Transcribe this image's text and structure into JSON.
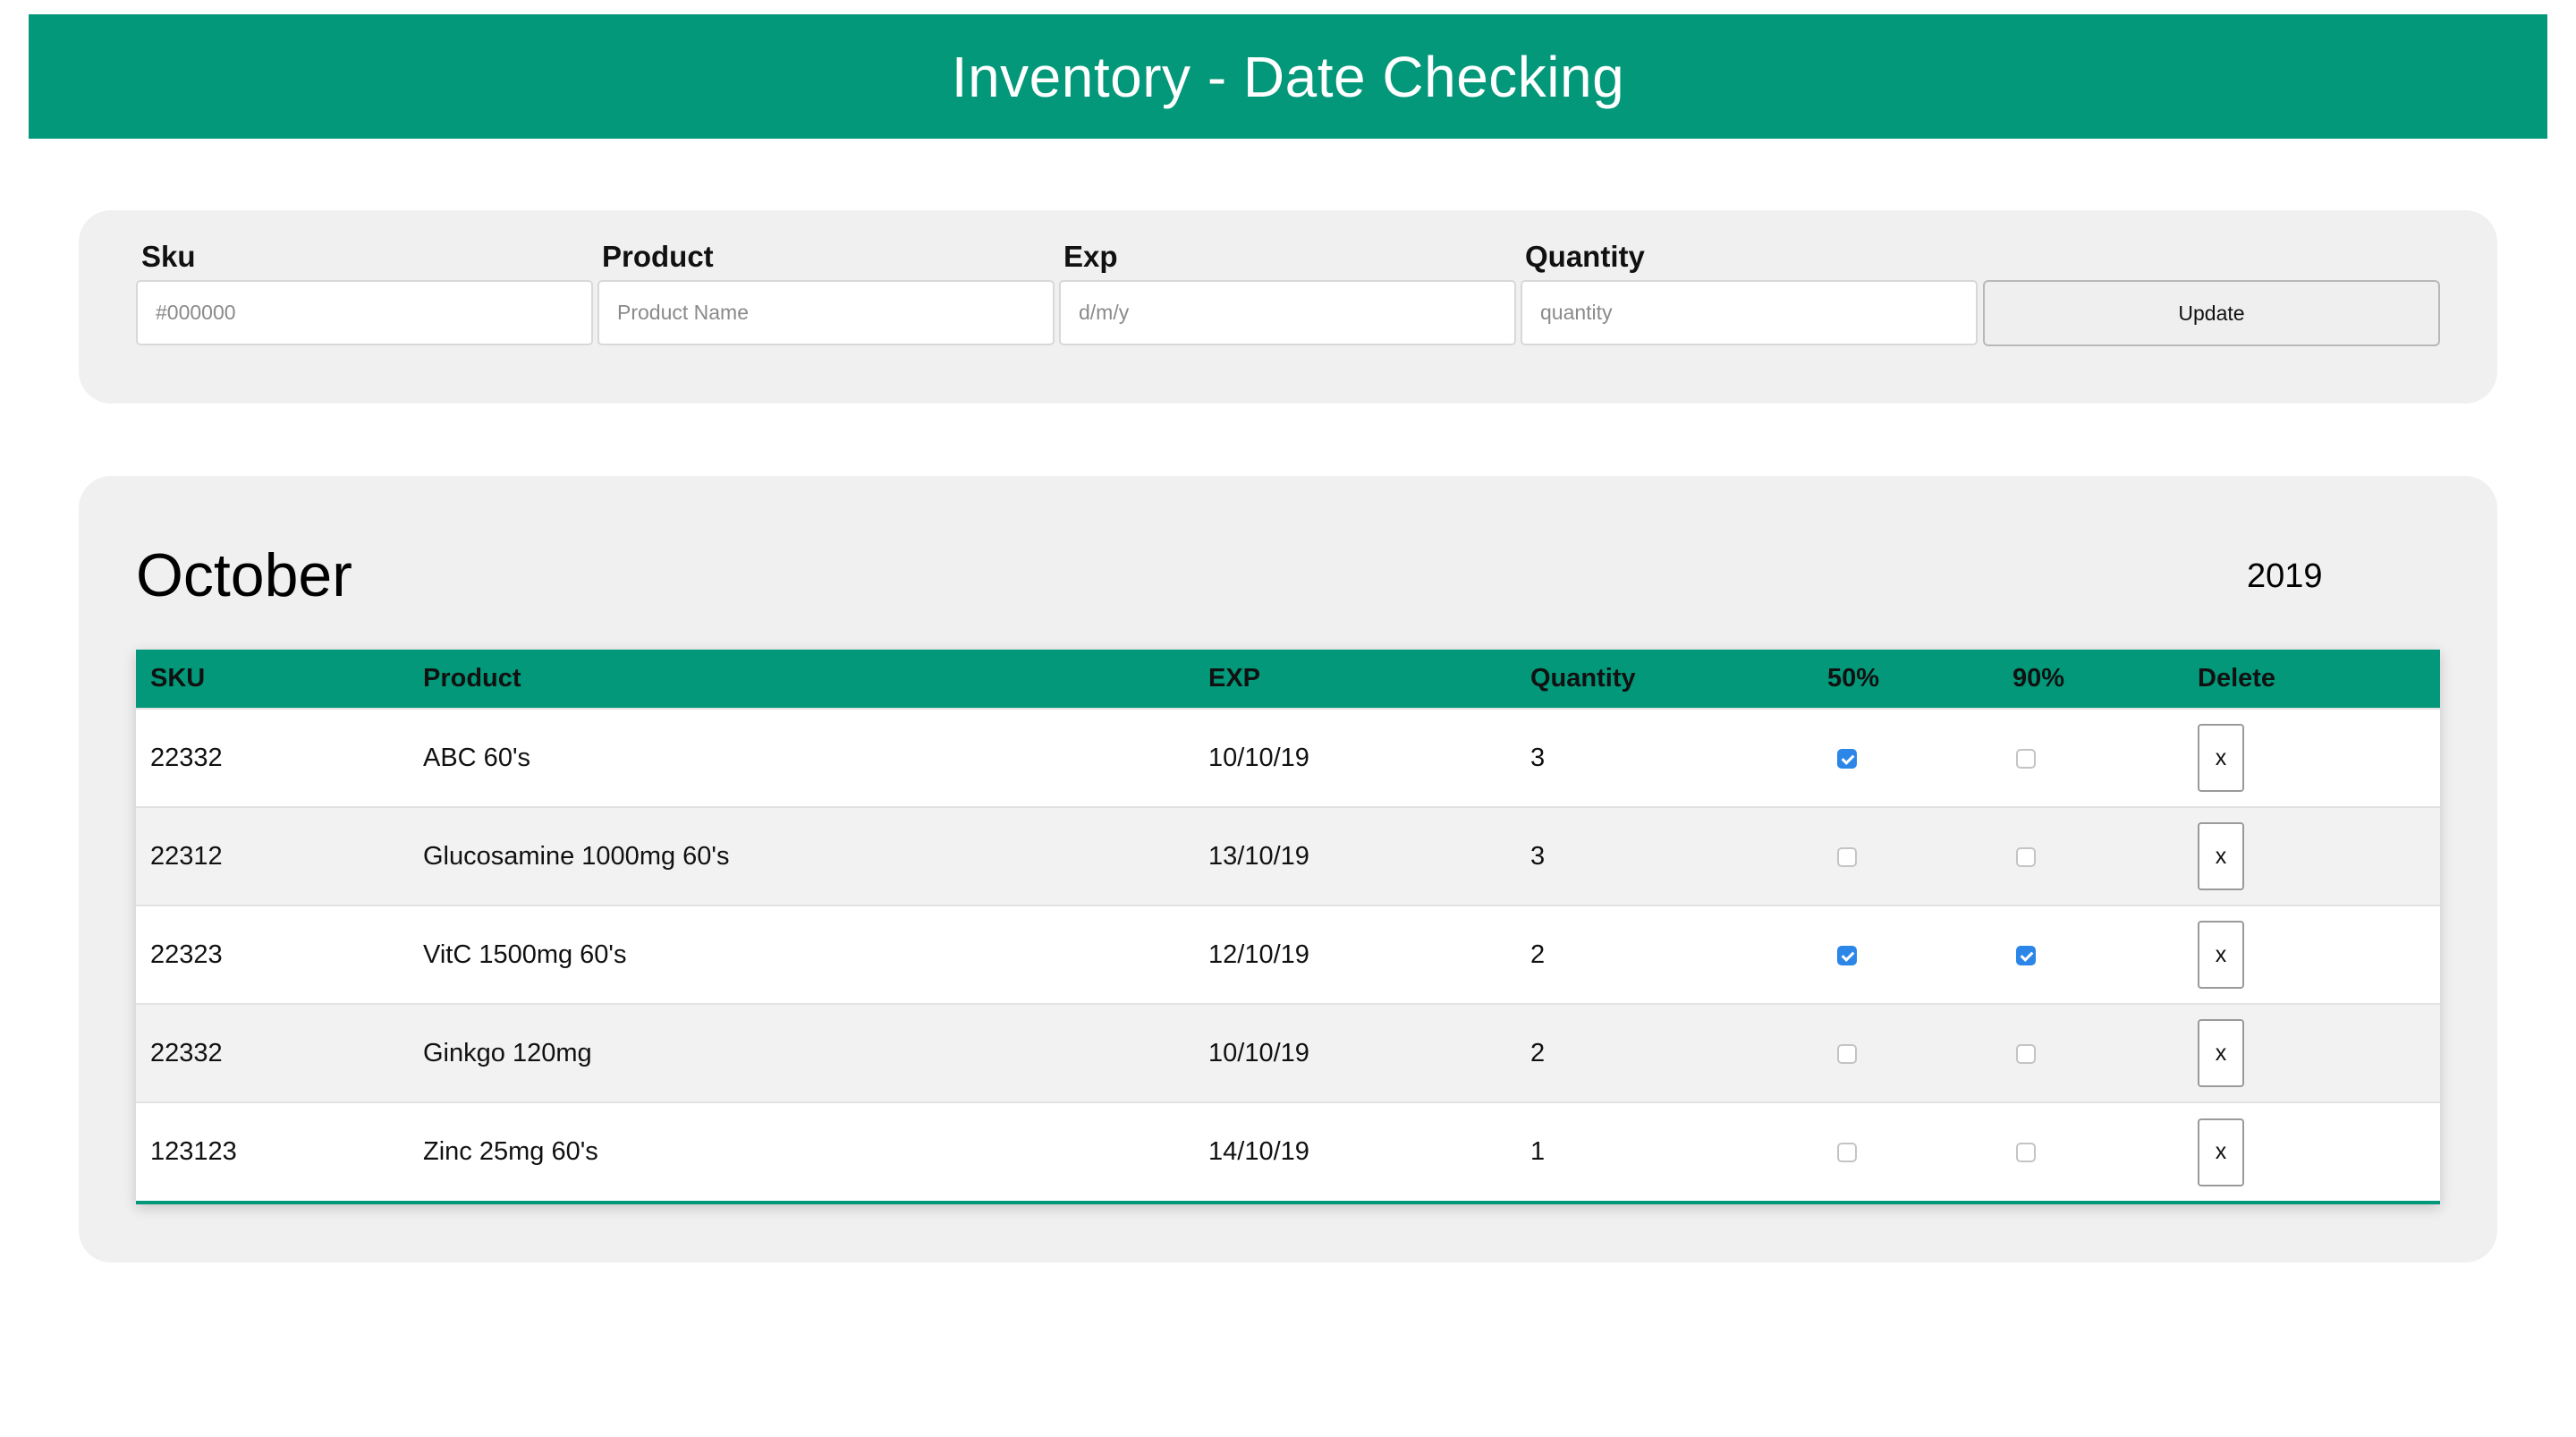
{
  "header": {
    "title": "Inventory - Date Checking"
  },
  "form": {
    "sku_label": "Sku",
    "sku_placeholder": "#000000",
    "product_label": "Product",
    "product_placeholder": "Product Name",
    "exp_label": "Exp",
    "exp_placeholder": "d/m/y",
    "quantity_label": "Quantity",
    "quantity_placeholder": "quantity",
    "update_label": "Update"
  },
  "list": {
    "month": "October",
    "year": "2019",
    "columns": {
      "sku": "SKU",
      "product": "Product",
      "exp": "EXP",
      "quantity": "Quantity",
      "p50": "50%",
      "p90": "90%",
      "delete": "Delete"
    },
    "delete_label": "x",
    "rows": [
      {
        "sku": "22332",
        "product": "ABC 60's",
        "exp": "10/10/19",
        "quantity": "3",
        "p50": true,
        "p90": false
      },
      {
        "sku": "22312",
        "product": "Glucosamine 1000mg 60's",
        "exp": "13/10/19",
        "quantity": "3",
        "p50": false,
        "p90": false
      },
      {
        "sku": "22323",
        "product": "VitC 1500mg 60's",
        "exp": "12/10/19",
        "quantity": "2",
        "p50": true,
        "p90": true
      },
      {
        "sku": "22332",
        "product": "Ginkgo 120mg",
        "exp": "10/10/19",
        "quantity": "2",
        "p50": false,
        "p90": false
      },
      {
        "sku": "123123",
        "product": "Zinc 25mg 60's",
        "exp": "14/10/19",
        "quantity": "1",
        "p50": false,
        "p90": false
      }
    ]
  },
  "colors": {
    "accent": "#039879",
    "panel": "#f0f0f0",
    "checkbox_checked": "#2b86e8"
  }
}
